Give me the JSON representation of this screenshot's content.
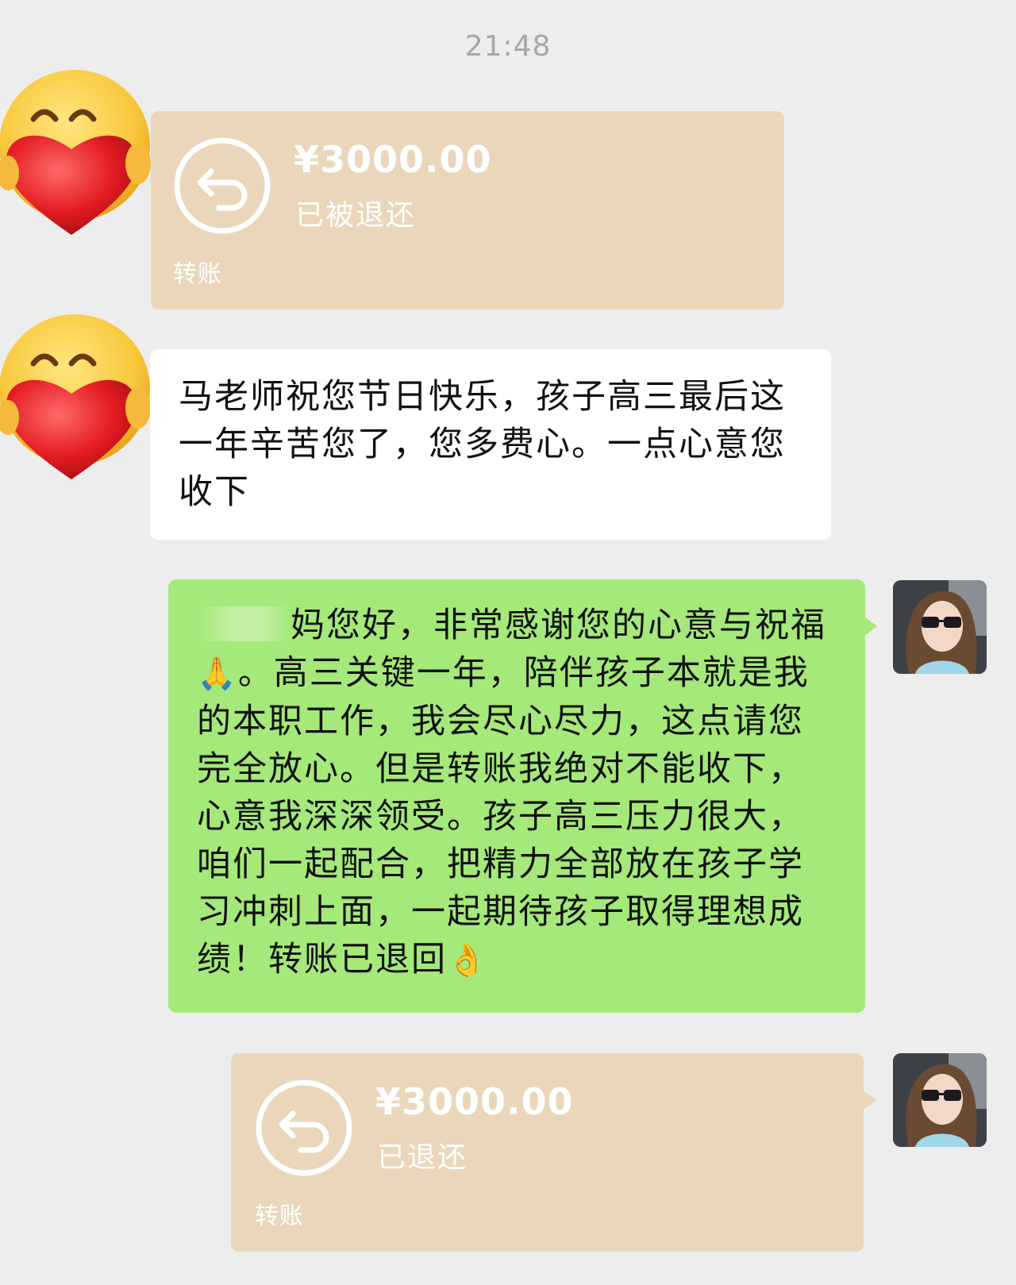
{
  "chat": {
    "timestamp": "21:48",
    "messages": [
      {
        "type": "transfer",
        "amount": "¥3000.00",
        "status": "已被退还",
        "label": "转账"
      },
      {
        "type": "text",
        "text": "马老师祝您节日快乐，孩子高三最后这一年辛苦您了，您多费心。一点心意您收下"
      },
      {
        "type": "text",
        "text_part1": "妈您好，非常感谢您的心意与祝福",
        "emoji1": "🙏",
        "text_part2": "。高三关键一年，陪伴孩子本就是我的本职工作，我会尽心尽力，这点请您完全放心。但是转账我绝对不能收下，心意我深深领受。孩子高三压力很大，咱们一起配合，把精力全部放在孩子学习冲刺上面，一起期待孩子取得理想成绩！转账已退回",
        "emoji2": "👌"
      },
      {
        "type": "transfer",
        "amount": "¥3000.00",
        "status": "已退还",
        "label": "转账"
      }
    ]
  },
  "colors": {
    "background": "#ededed",
    "green_bubble": "#a4e979",
    "white_bubble": "#ffffff",
    "transfer_bubble": "#ead7bb"
  }
}
